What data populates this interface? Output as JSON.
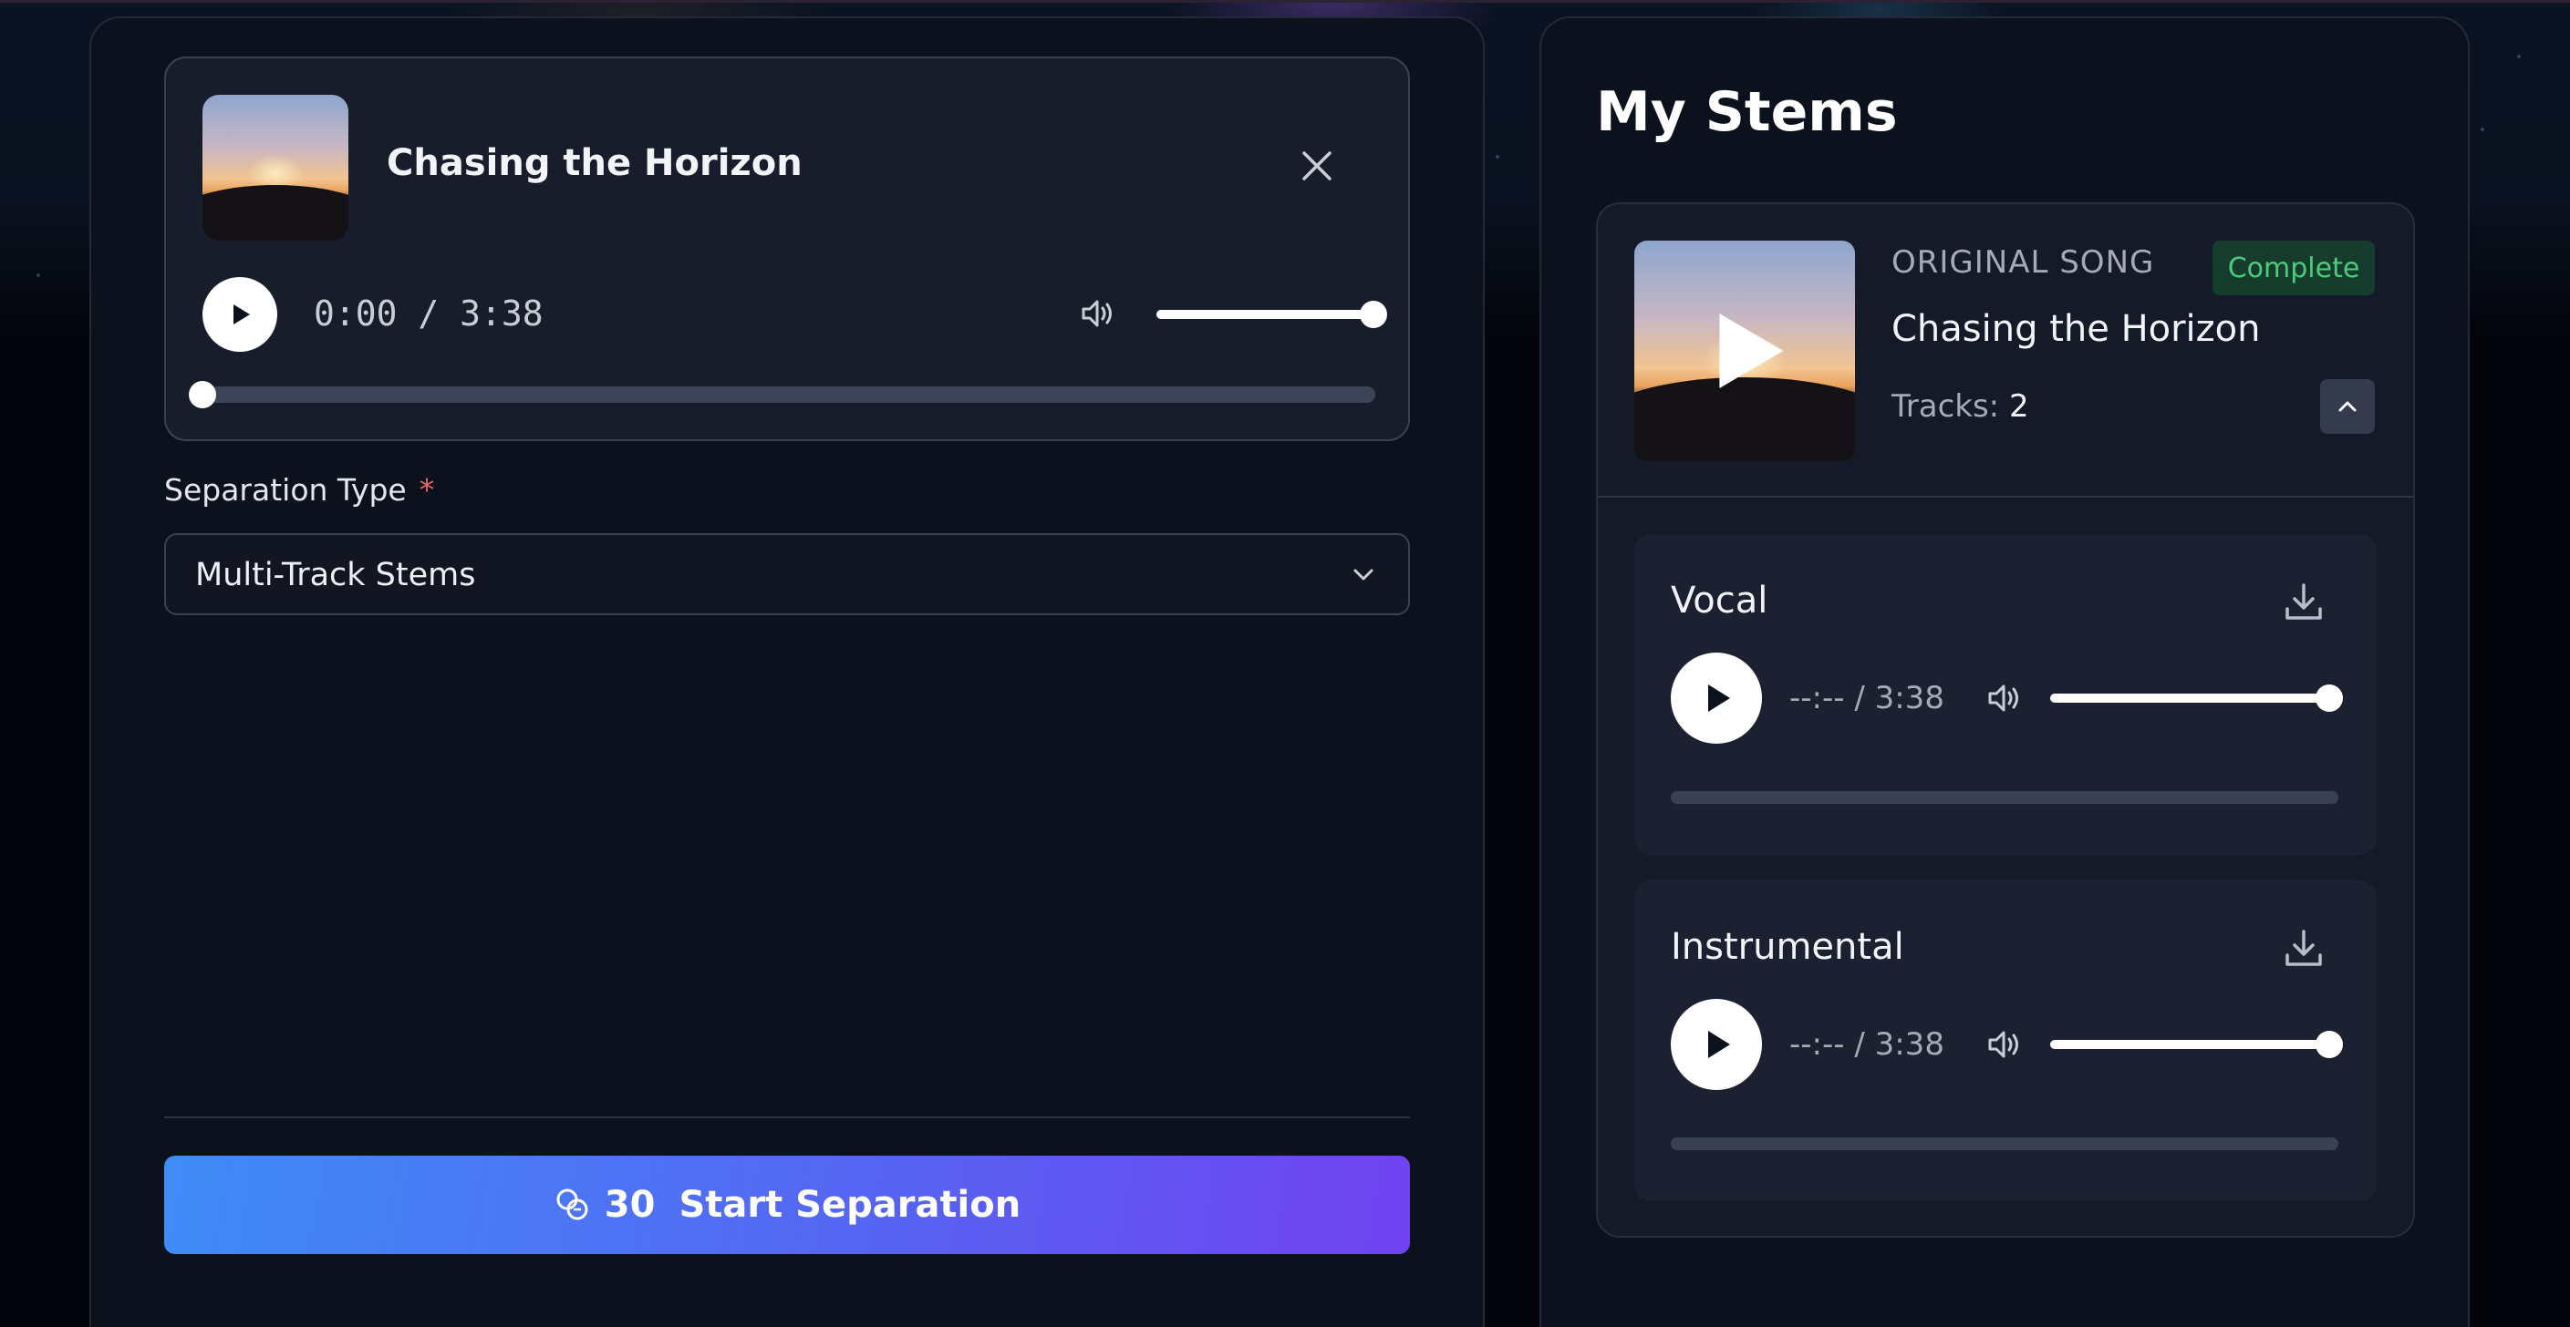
{
  "player": {
    "title": "Chasing the Horizon",
    "time": "0:00 / 3:38",
    "volume_fraction": 1.0,
    "progress_fraction": 0.0
  },
  "separation": {
    "label": "Separation Type",
    "required_mark": "*",
    "selected": "Multi-Track Stems"
  },
  "start_button": {
    "credits": "30",
    "label": "Start Separation"
  },
  "stems": {
    "title": "My Stems",
    "group": {
      "original_label": "ORIGINAL SONG",
      "status": "Complete",
      "song_title": "Chasing the Horizon",
      "tracks_label": "Tracks:",
      "tracks_count": "2"
    },
    "tracks": [
      {
        "name": "Vocal",
        "time": "--:-- / 3:38",
        "volume_fraction": 1.0,
        "progress_fraction": 0.0
      },
      {
        "name": "Instrumental",
        "time": "--:-- / 3:38",
        "volume_fraction": 1.0,
        "progress_fraction": 0.0
      }
    ]
  },
  "colors": {
    "accent_start": "#3f8cf7",
    "accent_end": "#7042f0",
    "status_complete": "#4ccb7b",
    "required": "#f0655c"
  },
  "icons": {
    "close": "close-icon",
    "play": "play-icon",
    "volume": "volume-icon",
    "chevron": "chevron-down-icon",
    "credits": "coins-icon",
    "download": "download-icon",
    "collapse": "chevron-up-icon"
  }
}
